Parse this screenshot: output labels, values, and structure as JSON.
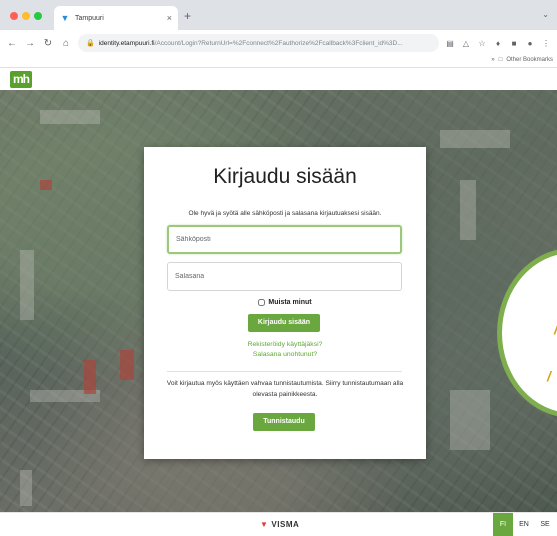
{
  "browser": {
    "tab_title": "Tampuuri",
    "strip_caption": "",
    "url_host": "identity.etampuuri.fi",
    "url_path": "/Account/Login?ReturnUrl=%2Fconnect%2Fauthorize%2Fcallback%3Fclient_id%3D...",
    "bookmarks_label": "Other Bookmarks"
  },
  "login": {
    "title": "Kirjaudu sisään",
    "instructions": "Ole hyvä ja syötä alle sähköposti ja salasana kirjautuaksesi sisään.",
    "email_placeholder": "Sähköposti",
    "password_placeholder": "Salasana",
    "remember_label": "Muista minut",
    "login_button": "Kirjaudu sisään",
    "register_link": "Rekisteröidy käyttäjäksi?",
    "forgot_link": "Salasana unohtunut?",
    "alt_auth_text": "Voit kirjautua myös käyttäen vahvaa tunnistautumista. Siirry tunnistautumaan alla olevasta painikkeesta.",
    "auth_button": "Tunnistaudu"
  },
  "footer": {
    "brand": "VISMA",
    "languages": [
      "FI",
      "EN",
      "SE"
    ],
    "active_language": "FI"
  },
  "logo": {
    "text": "mh"
  },
  "colors": {
    "accent": "#6aa83f",
    "frame": "#7fae4e",
    "link": "#5ea836"
  }
}
